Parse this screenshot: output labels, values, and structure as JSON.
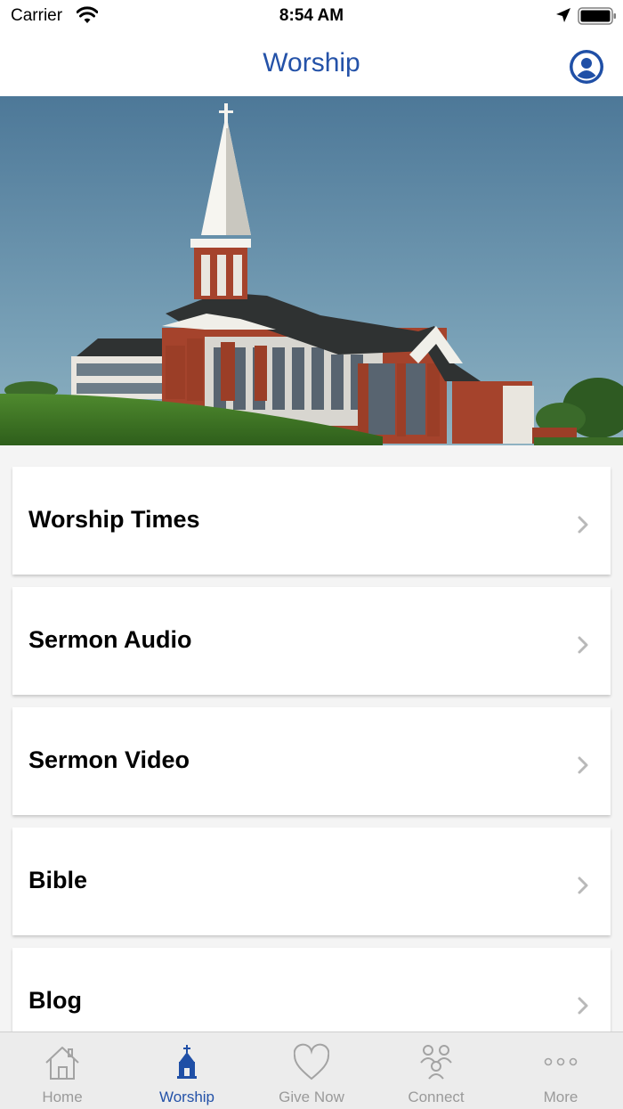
{
  "status_bar": {
    "carrier": "Carrier",
    "time": "8:54 AM"
  },
  "nav": {
    "title": "Worship"
  },
  "list": {
    "items": [
      {
        "label": "Worship Times"
      },
      {
        "label": "Sermon Audio"
      },
      {
        "label": "Sermon Video"
      },
      {
        "label": "Bible"
      },
      {
        "label": "Blog"
      }
    ]
  },
  "tabs": [
    {
      "label": "Home",
      "icon": "home-icon"
    },
    {
      "label": "Worship",
      "icon": "church-icon",
      "active": true
    },
    {
      "label": "Give Now",
      "icon": "heart-icon"
    },
    {
      "label": "Connect",
      "icon": "people-icon"
    },
    {
      "label": "More",
      "icon": "more-icon"
    }
  ],
  "colors": {
    "accent": "#2452a8",
    "inactive": "#9a9a9a",
    "background": "#f4f4f4"
  }
}
